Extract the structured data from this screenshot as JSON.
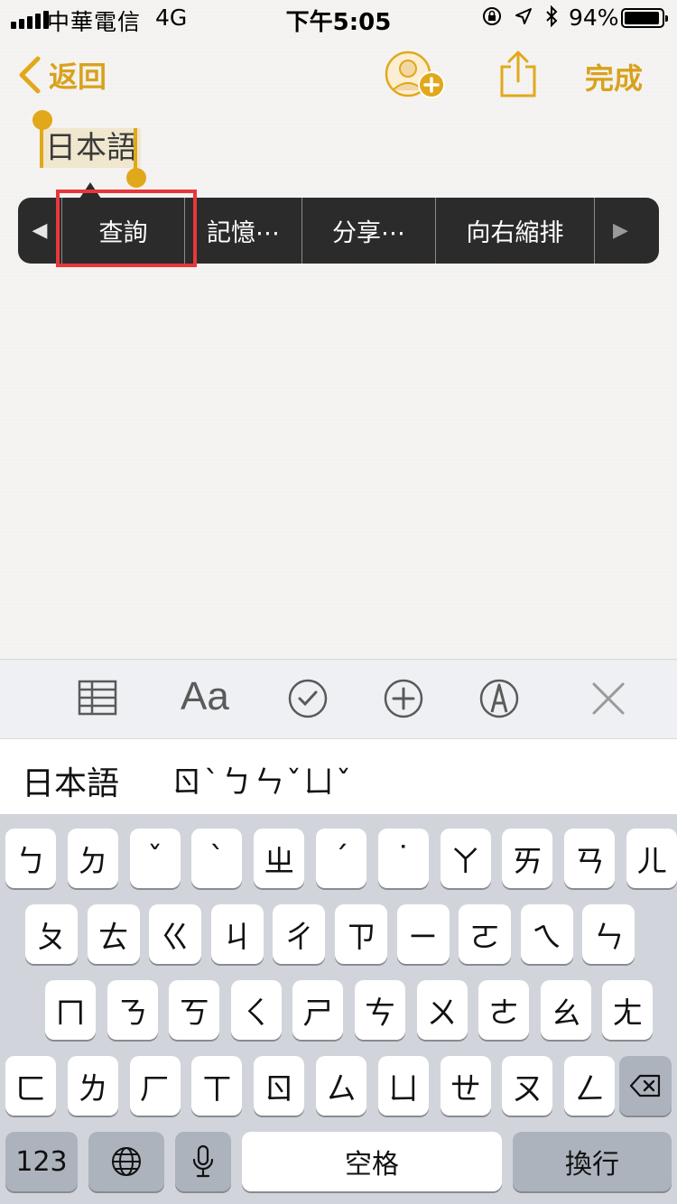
{
  "status": {
    "carrier": "中華電信",
    "network": "4G",
    "time": "下午5:05",
    "battery": "94%",
    "battery_level": 0.94
  },
  "nav": {
    "back_label": "返回",
    "done_label": "完成"
  },
  "note": {
    "selected_text": "日本語"
  },
  "edit_menu": {
    "items": [
      "查詢",
      "記憶⋯",
      "分享⋯",
      "向右縮排"
    ]
  },
  "colors": {
    "accent": "#d9a21c",
    "highlight": "#e8373b",
    "menu_bg": "#2b2b2b"
  },
  "toolbar": {
    "icons": [
      "table-icon",
      "text-format-icon",
      "checklist-icon",
      "add-icon",
      "markup-icon",
      "close-icon"
    ],
    "format_label": "Aa"
  },
  "candidates": {
    "word": "日本語",
    "composition": "ㄖˋㄅㄣˇㄩˇ"
  },
  "keyboard": {
    "row1": [
      "ㄅ",
      "ㄉ",
      "ˇ",
      "ˋ",
      "ㄓ",
      "ˊ",
      "˙",
      "ㄚ",
      "ㄞ",
      "ㄢ",
      "ㄦ"
    ],
    "row2": [
      "ㄆ",
      "ㄊ",
      "ㄍ",
      "ㄐ",
      "ㄔ",
      "ㄗ",
      "ㄧ",
      "ㄛ",
      "ㄟ",
      "ㄣ"
    ],
    "row3": [
      "ㄇ",
      "ㄋ",
      "ㄎ",
      "ㄑ",
      "ㄕ",
      "ㄘ",
      "ㄨ",
      "ㄜ",
      "ㄠ",
      "ㄤ"
    ],
    "row4": [
      "ㄈ",
      "ㄌ",
      "ㄏ",
      "ㄒ",
      "ㄖ",
      "ㄙ",
      "ㄩ",
      "ㄝ",
      "ㄡ",
      "ㄥ"
    ],
    "numbers_label": "123",
    "space_label": "空格",
    "return_label": "換行"
  }
}
